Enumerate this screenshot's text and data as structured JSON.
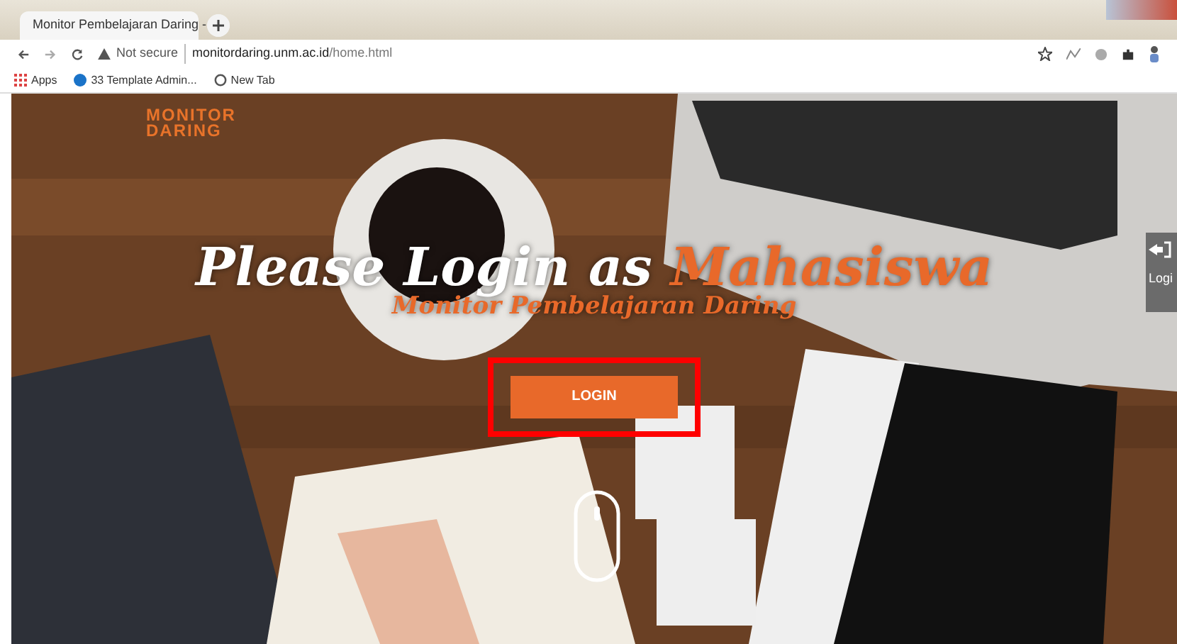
{
  "browser": {
    "tab_title": "Monitor Pembelajaran Daring - ",
    "security": "Not secure",
    "url_host": "monitordaring.unm.ac.id",
    "url_path": "/home.html",
    "bookmarks": [
      {
        "label": "Apps",
        "kind": "apps"
      },
      {
        "label": "33 Template Admin...",
        "kind": "site"
      },
      {
        "label": "New Tab",
        "kind": "globe"
      }
    ]
  },
  "page": {
    "logo": [
      "MONITOR",
      "DARING"
    ],
    "heading": "Please Login as",
    "heading_accent": "Mahasiswa",
    "subtitle": "Monitor Pembelajaran Daring",
    "login_button": {
      "label": "LOGIN",
      "highlighted": true
    },
    "side_tab": {
      "label": "Logi"
    }
  }
}
